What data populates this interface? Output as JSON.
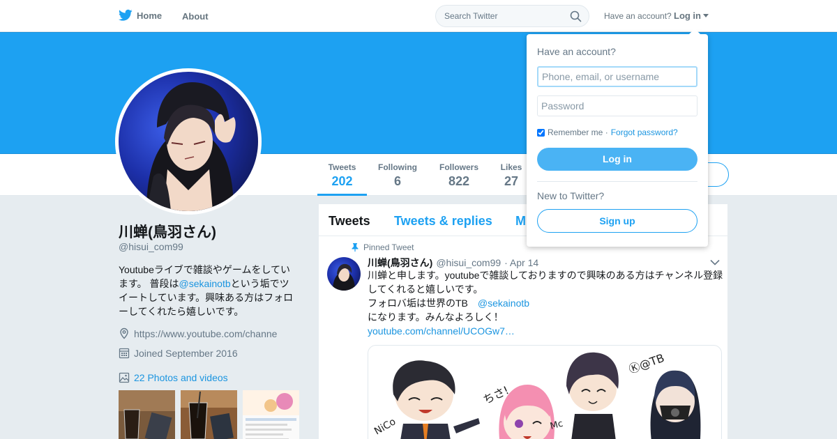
{
  "nav": {
    "home_label": "Home",
    "about_label": "About",
    "search_placeholder": "Search Twitter",
    "have_account": "Have an account?",
    "login_label": "Log in"
  },
  "profile": {
    "name": "川蝉(鳥羽さん)",
    "handle": "@hisui_com99",
    "bio_part1": "Youtubeライブで雑談やゲームをしています。 普段は",
    "bio_mention": "@sekainotb",
    "bio_part2": "という垢でツイートしています。興味ある方はフォローしてくれたら嬉しいです。",
    "url": "https://www.youtube.com/channe",
    "joined": "Joined September 2016",
    "photos_label": "22 Photos and videos"
  },
  "stats": [
    {
      "label": "Tweets",
      "value": "202"
    },
    {
      "label": "Following",
      "value": "6"
    },
    {
      "label": "Followers",
      "value": "822"
    },
    {
      "label": "Likes",
      "value": "27"
    }
  ],
  "timeline": {
    "tabs": [
      "Tweets",
      "Tweets & replies",
      "M"
    ],
    "pinned_label": "Pinned Tweet",
    "tweet": {
      "name": "川蝉(鳥羽さん)",
      "handle": "@hisui_com99",
      "date": "· Apr 14",
      "line1": "川蝉と申します。youtubeで雑談しておりますので興味のある方はチャンネル登録してくれると嬉しいです。",
      "line2": "フォロバ垢は世界のTB　",
      "mention": "@sekainotb",
      "line3": "になります。みんなよろしく！",
      "link": "youtube.com/channel/UCOGw7…"
    }
  },
  "login_dropdown": {
    "title": "Have an account?",
    "username_placeholder": "Phone, email, or username",
    "password_placeholder": "Password",
    "remember_label": "Remember me ·",
    "forgot_label": "Forgot password?",
    "login_button": "Log in",
    "new_label": "New to Twitter?",
    "signup_button": "Sign up"
  },
  "colors": {
    "brand": "#1da1f2",
    "link": "#1b95e0",
    "muted": "#657786"
  }
}
